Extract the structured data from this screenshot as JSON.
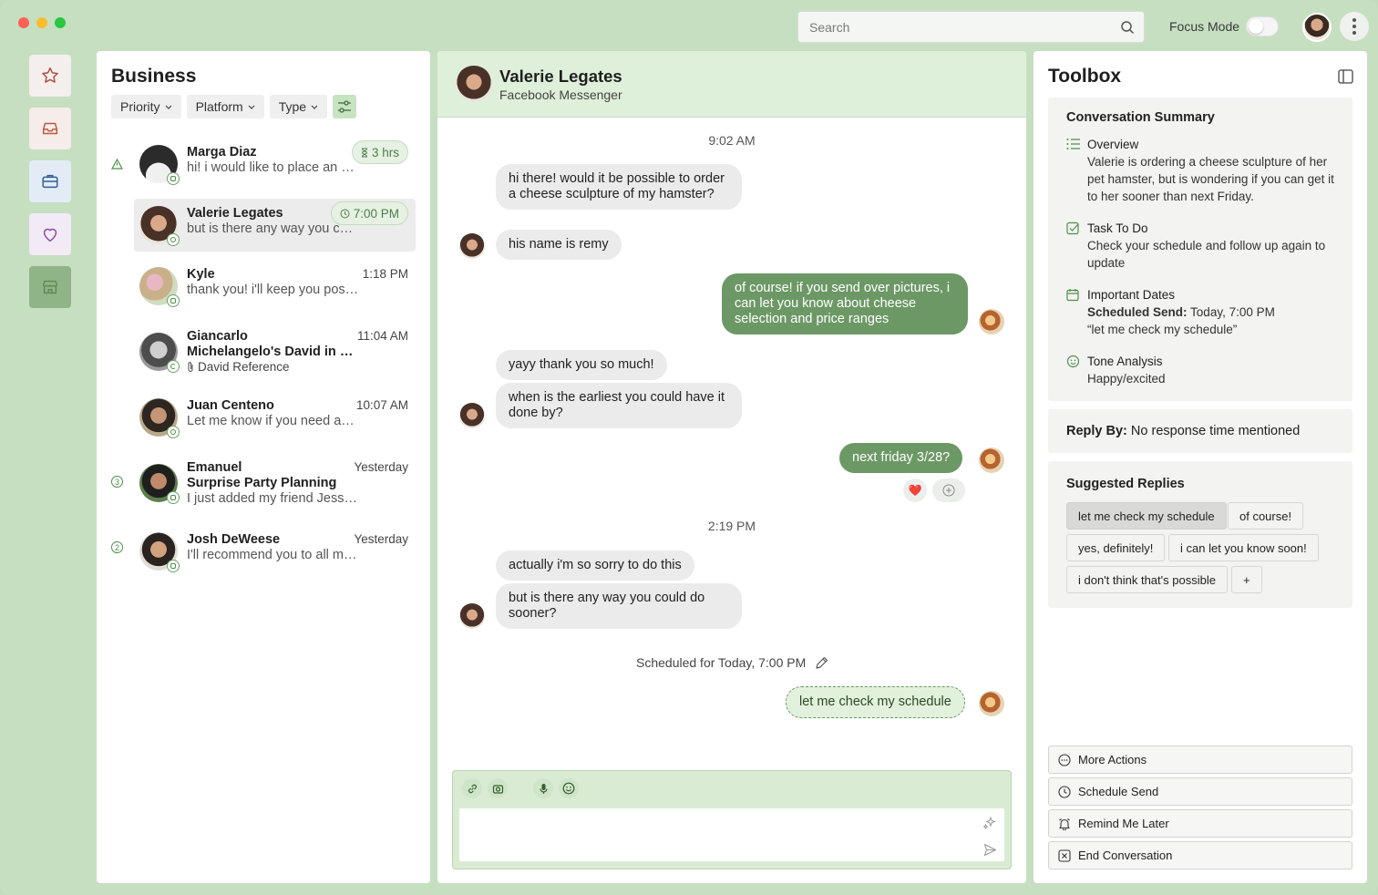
{
  "topbar": {
    "search_placeholder": "Search",
    "focus_mode_label": "Focus Mode"
  },
  "conversation_list": {
    "title": "Business",
    "filters": [
      "Priority",
      "Platform",
      "Type"
    ],
    "items": [
      {
        "name": "Marga Diaz",
        "preview": "hi! i would like to place an order for a cheese",
        "time": "3 hrs",
        "time_style": "pill-timer",
        "marker": "alert",
        "platform": "instagram"
      },
      {
        "name": "Valerie Legates",
        "preview": "but is there any way you could do sooner?",
        "time": "7:00 PM",
        "time_style": "pill-clock",
        "marker": "",
        "platform": "messenger"
      },
      {
        "name": "Kyle",
        "preview": "thank you! i'll keep you posted on",
        "time": "1:18 PM",
        "time_style": "plain",
        "marker": "",
        "platform": "instagram"
      },
      {
        "name": "Giancarlo",
        "subject": "Michelangelo's David in Gouda",
        "preview": "David Reference",
        "time": "11:04 AM",
        "time_style": "plain",
        "marker": "",
        "platform": "google"
      },
      {
        "name": "Juan Centeno",
        "preview": "Let me know if you need anything",
        "time": "10:07 AM",
        "time_style": "plain",
        "marker": "",
        "platform": "whatsapp"
      },
      {
        "name": "Emanuel",
        "subject": "Surprise Party Planning",
        "preview": "I just added my friend Jessica",
        "time": "Yesterday",
        "time_style": "plain",
        "marker": "3",
        "platform": "instagram"
      },
      {
        "name": "Josh DeWeese",
        "preview": "I'll recommend you to all my friends",
        "time": "Yesterday",
        "time_style": "plain",
        "marker": "2",
        "platform": "instagram"
      }
    ]
  },
  "chat": {
    "contact_name": "Valerie Legates",
    "platform": "Facebook Messenger",
    "timestamps": [
      "9:02 AM",
      "2:19 PM"
    ],
    "messages": [
      {
        "dir": "in",
        "text": "hi there! would it be possible to order a cheese sculpture of my hamster?"
      },
      {
        "dir": "in",
        "text": "his name is remy"
      },
      {
        "dir": "out",
        "text": "of course! if you send over pictures, i can let you know about cheese selection and price ranges"
      },
      {
        "dir": "in",
        "text": "yayy thank you so much!"
      },
      {
        "dir": "in",
        "text": "when is the earliest you could have it done by?"
      },
      {
        "dir": "out",
        "text": "next friday 3/28?"
      },
      {
        "dir": "in",
        "text": "actually i'm so sorry to do this"
      },
      {
        "dir": "in",
        "text": "but is there any way you could do sooner?"
      }
    ],
    "reaction": "❤️",
    "scheduled_note": "Scheduled for Today, 7:00 PM",
    "scheduled_message": "let me check my schedule"
  },
  "toolbox": {
    "title": "Toolbox",
    "summary_title": "Conversation Summary",
    "overview_label": "Overview",
    "overview_text": "Valerie is ordering a cheese sculpture of her pet hamster, but is wondering if you can get it to her sooner than next Friday.",
    "task_label": "Task To Do",
    "task_text": "Check your schedule and follow up again to update",
    "dates_label": "Important Dates",
    "dates_key": "Scheduled Send:",
    "dates_value": "Today, 7:00 PM",
    "dates_quote": "“let me check my schedule”",
    "tone_label": "Tone Analysis",
    "tone_text": "Happy/excited",
    "reply_by_key": "Reply By:",
    "reply_by_value": "No response time mentioned",
    "suggested_title": "Suggested Replies",
    "suggested": [
      "let me check my schedule",
      "of course!",
      "yes, definitely!",
      "i can let you know soon!",
      "i don't think that's possible",
      "+"
    ],
    "actions": [
      "More Actions",
      "Schedule Send",
      "Remind Me Later",
      "End Conversation"
    ]
  },
  "colors": {
    "background": "#c6dfc1",
    "accent": "#6c9866",
    "chat_header": "#dff0da"
  }
}
